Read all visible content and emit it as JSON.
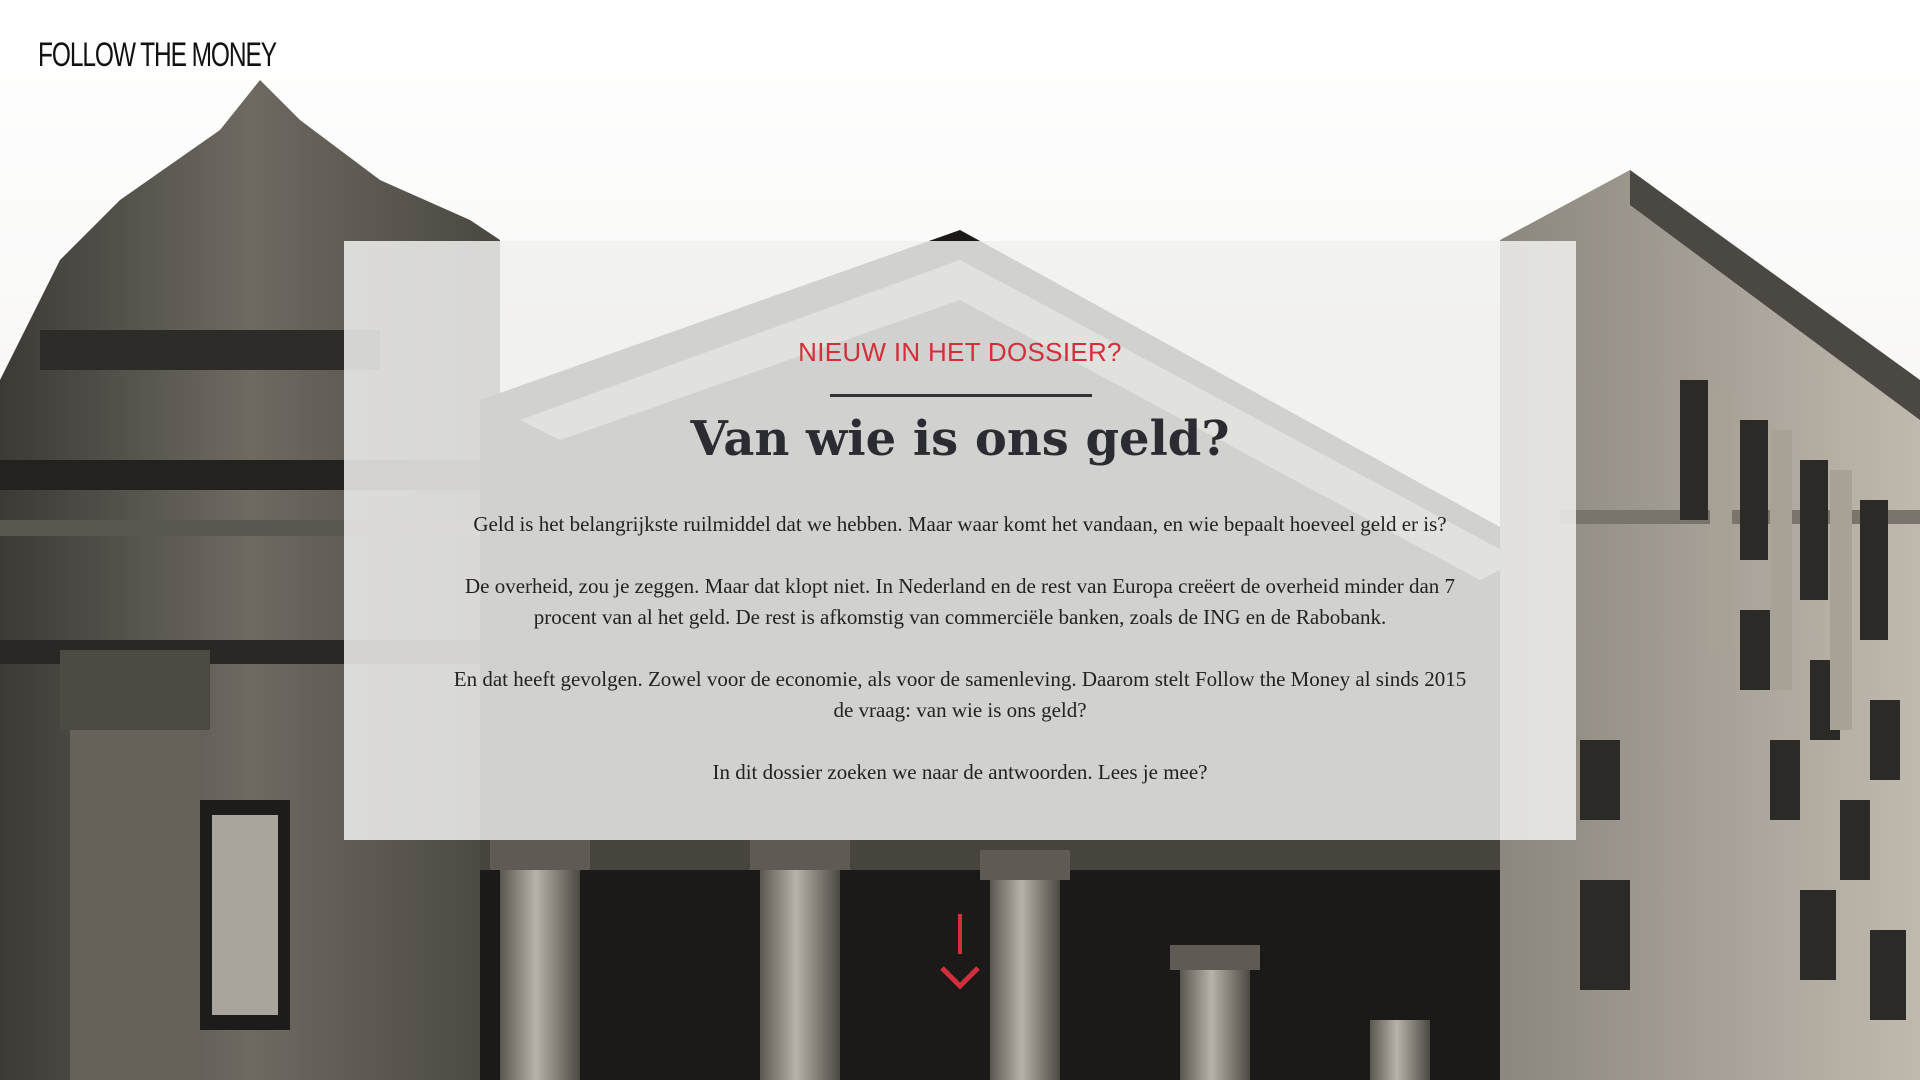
{
  "header": {
    "logo_text": "FOLLOW THE MONEY"
  },
  "intro": {
    "kicker": "NIEUW IN HET DOSSIER?",
    "title": "Van wie is ons geld?",
    "paragraphs": [
      "Geld is het belangrijkste ruilmiddel dat we hebben. Maar waar komt het vandaan, en wie bepaalt hoeveel geld er is?",
      "De overheid, zou je zeggen. Maar dat klopt niet. In Nederland en de rest van Europa creëert de overheid minder dan 7 procent van al het geld. De rest is afkomstig van commerciële banken, zoals de ING en de Rabobank.",
      "En dat heeft gevolgen. Zowel voor de economie, als voor de samenleving. Daarom stelt Follow the Money al sinds 2015 de vraag: van wie is ons geld?",
      "In dit dossier zoeken we naar de antwoorden. Lees je mee?"
    ]
  },
  "scroll_down": {
    "icon": "arrow-down-icon",
    "color": "#d32f3a"
  },
  "colors": {
    "accent": "#d32f3a",
    "title": "#2a2c31"
  }
}
